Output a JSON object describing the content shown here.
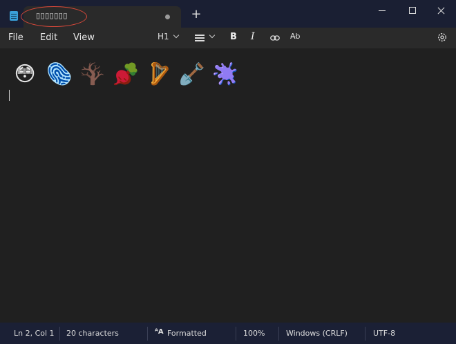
{
  "window": {
    "tab_title": "▯▯▯▯▯▯▯",
    "new_tab": "+"
  },
  "menu": {
    "file": "File",
    "edit": "Edit",
    "view": "View"
  },
  "toolbar": {
    "heading": "H1",
    "bold": "B",
    "italic": "I",
    "spellcheck": "A̶b"
  },
  "editor": {
    "emojis": [
      {
        "name": "flushed-face",
        "char": "😳"
      },
      {
        "name": "fingerprint",
        "char": "🫆"
      },
      {
        "name": "leafless-tree",
        "char": "🪾"
      },
      {
        "name": "root-vegetable",
        "char": "🫜"
      },
      {
        "name": "harp",
        "char": "🪉"
      },
      {
        "name": "shovel",
        "char": "🪏"
      },
      {
        "name": "splatter",
        "char": "🫟"
      }
    ]
  },
  "status": {
    "position": "Ln 2, Col 1",
    "characters": "20 characters",
    "format": "Formatted",
    "format_icon": "ᴬA",
    "zoom": "100%",
    "line_ending": "Windows (CRLF)",
    "encoding": "UTF-8"
  }
}
